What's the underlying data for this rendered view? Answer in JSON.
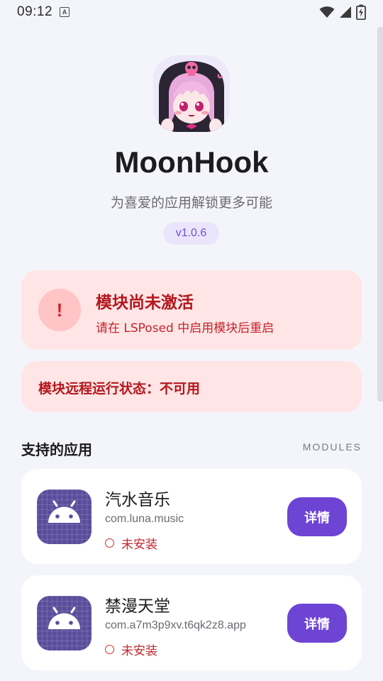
{
  "status_bar": {
    "time": "09:12",
    "notification_glyph": "A",
    "icons": [
      "wifi-icon",
      "signal-icon",
      "battery-charging-icon"
    ]
  },
  "header": {
    "title": "MoonHook",
    "subtitle": "为喜爱的应用解锁更多可能",
    "version": "v1.0.6",
    "avatar_icon": "anime-avatar-icon"
  },
  "warning": {
    "icon_glyph": "!",
    "title": "模块尚未激活",
    "subtitle": "请在 LSPosed 中启用模块后重启"
  },
  "remote_status": {
    "text": "模块远程运行状态：不可用"
  },
  "section": {
    "title": "支持的应用",
    "tag": "MODULES"
  },
  "apps": [
    {
      "name": "汽水音乐",
      "package": "com.luna.music",
      "status": "未安装",
      "button_label": "详情",
      "icon": "android-icon"
    },
    {
      "name": "禁漫天堂",
      "package": "com.a7m3p9xv.t6qk2z8.app",
      "status": "未安装",
      "button_label": "详情",
      "icon": "android-icon"
    }
  ],
  "colors": {
    "background": "#f4f5fa",
    "accent": "#6e44d4",
    "warning_bg": "#ffe5e6",
    "warning_text": "#b3171d",
    "app_icon_bg": "#5a4e9c"
  }
}
